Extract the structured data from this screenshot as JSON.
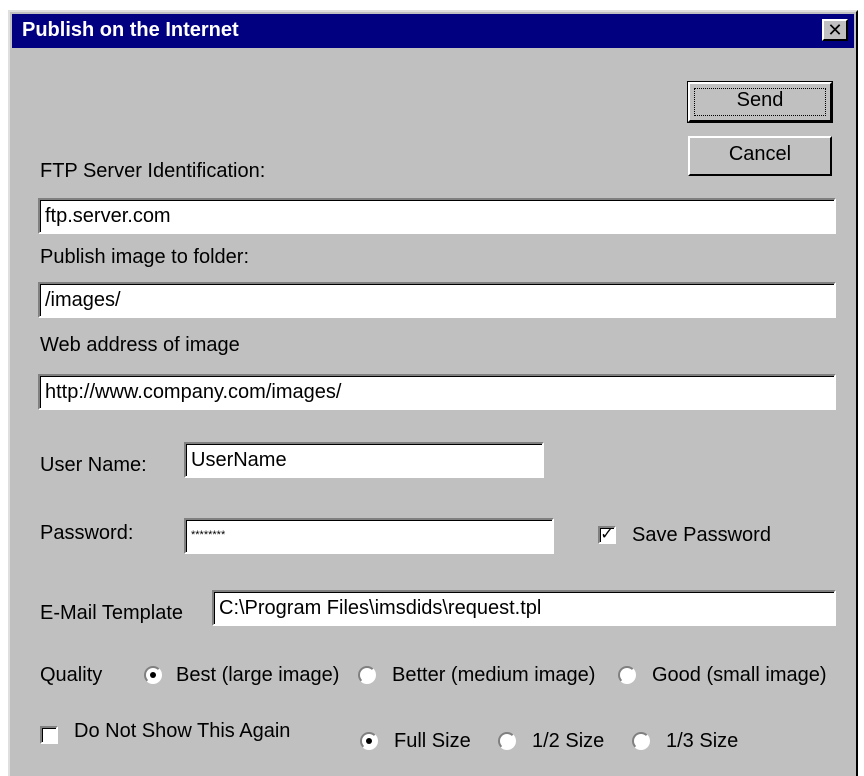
{
  "window": {
    "title": "Publish on the Internet",
    "close_glyph": "✕"
  },
  "buttons": {
    "send": "Send",
    "cancel": "Cancel"
  },
  "ftp": {
    "label": "FTP Server Identification:",
    "value": "ftp.server.com"
  },
  "folder": {
    "label": "Publish image to folder:",
    "value": "/images/"
  },
  "web": {
    "label": "Web address of image",
    "value": "http://www.company.com/images/"
  },
  "user": {
    "label": "User Name:",
    "value": "UserName"
  },
  "password": {
    "label": "Password:",
    "value": "********",
    "save_label": "Save Password",
    "save_checked": true
  },
  "email": {
    "label": "E-Mail Template",
    "value": "C:\\Program Files\\imsdids\\request.tpl"
  },
  "quality": {
    "label": "Quality",
    "options": [
      {
        "label": "Best (large image)",
        "selected": true
      },
      {
        "label": "Better (medium image)",
        "selected": false
      },
      {
        "label": "Good (small image)",
        "selected": false
      }
    ]
  },
  "dont_show": {
    "label": "Do Not Show This Again",
    "checked": false
  },
  "size": {
    "options": [
      {
        "label": "Full Size",
        "selected": true
      },
      {
        "label": "1/2 Size",
        "selected": false
      },
      {
        "label": "1/3 Size",
        "selected": false
      }
    ]
  },
  "check_glyph": "✓"
}
